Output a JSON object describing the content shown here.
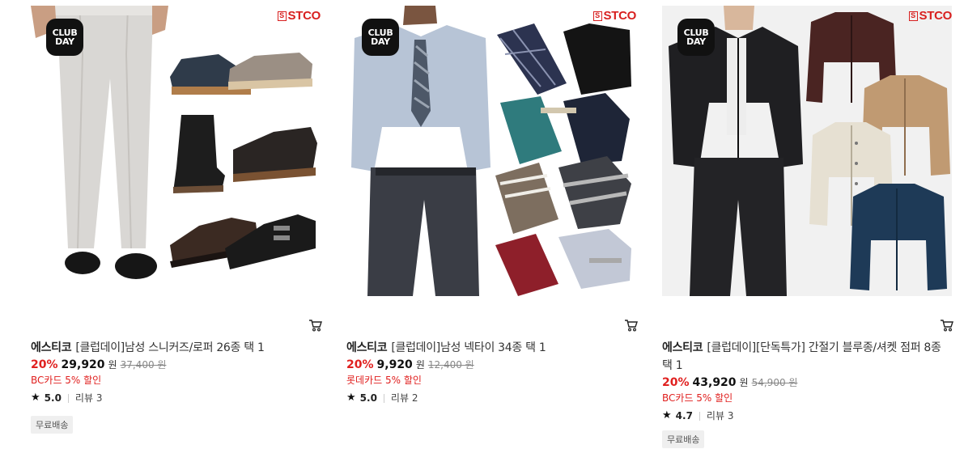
{
  "products": [
    {
      "badge_line1": "CLUB",
      "badge_line2": "DAY",
      "logo_mark": "S",
      "logo_text": "STCO",
      "brand": "에스티코",
      "name": "[클럽데이]남성 스니커즈/로퍼 26종 택 1",
      "discount": "20%",
      "price": "29,920",
      "currency": "원",
      "original_price": "37,400 원",
      "promo": "BC카드 5% 할인",
      "rating": "5.0",
      "reviews": "리뷰 3",
      "shipping_tag": "무료배송",
      "image": "shoes-collage"
    },
    {
      "badge_line1": "CLUB",
      "badge_line2": "DAY",
      "logo_mark": "S",
      "logo_text": "STCO",
      "brand": "에스티코",
      "name": "[클럽데이]남성 넥타이 34종 택 1",
      "discount": "20%",
      "price": "9,920",
      "currency": "원",
      "original_price": "12,400 원",
      "promo": "롯데카드 5% 할인",
      "rating": "5.0",
      "reviews": "리뷰 2",
      "image": "ties-collage"
    },
    {
      "badge_line1": "CLUB",
      "badge_line2": "DAY",
      "logo_mark": "S",
      "logo_text": "STCO",
      "brand": "에스티코",
      "name": "[클럽데이][단독특가] 간절기 블루종/셔켓 점퍼 8종 택 1",
      "discount": "20%",
      "price": "43,920",
      "currency": "원",
      "original_price": "54,900 원",
      "promo": "BC카드 5% 할인",
      "rating": "4.7",
      "reviews": "리뷰 3",
      "shipping_tag": "무료배송",
      "image": "jackets-collage"
    }
  ],
  "icons": {
    "cart": "cart-icon",
    "star": "star-icon"
  },
  "colors": {
    "discount": "#e0201f",
    "logo": "#d8201f",
    "badge_bg": "#111111"
  }
}
